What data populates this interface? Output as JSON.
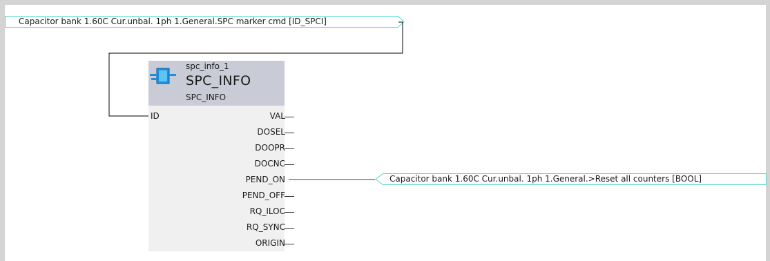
{
  "diagram": {
    "input_tag": {
      "label": "Capacitor bank 1.60C Cur.unbal. 1ph 1.General.SPC marker cmd [ID_SPCI]"
    },
    "output_tag": {
      "label": "Capacitor bank 1.60C Cur.unbal. 1ph 1.General.>Reset all counters [BOOL]"
    },
    "block": {
      "icon": "function-block-icon",
      "instance_name": "spc_info_1",
      "title": "SPC_INFO",
      "type_name": "SPC_INFO",
      "inputs": [
        "ID"
      ],
      "outputs": [
        "VAL",
        "DOSEL",
        "DOOPR",
        "DOCNC",
        "PEND_ON",
        "PEND_OFF",
        "RQ_ILOC",
        "RQ_SYNC",
        "ORIGIN"
      ]
    },
    "colors": {
      "tag_border": "#55d8cc",
      "wire_bool": "#8b1a1a",
      "wire_default": "#000000",
      "block_header": "#c9ccd6",
      "block_body": "#f0f0f0"
    }
  }
}
